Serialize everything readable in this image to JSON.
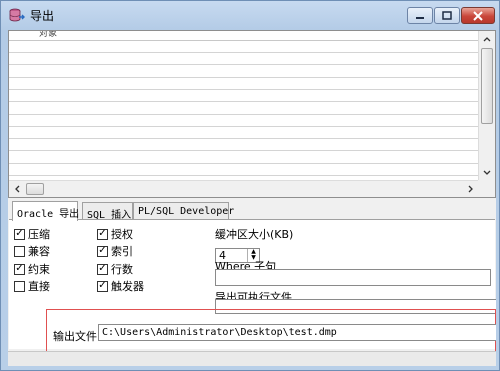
{
  "window": {
    "title": "导出",
    "icon": "database-export-icon",
    "minimize_glyph": "▬",
    "maximize_glyph": "▢",
    "close_glyph": "✕"
  },
  "grid": {
    "header_label": "对象",
    "row_count": 11
  },
  "tabs": [
    {
      "label": "Oracle 导出",
      "active": true
    },
    {
      "label": "SQL 插入",
      "active": false
    },
    {
      "label": "PL/SQL Developer",
      "active": false
    }
  ],
  "options_left": [
    {
      "label": "压缩",
      "checked": true
    },
    {
      "label": "兼容",
      "checked": false
    },
    {
      "label": "约束",
      "checked": true
    },
    {
      "label": "直接",
      "checked": false
    }
  ],
  "options_right": [
    {
      "label": "授权",
      "checked": true
    },
    {
      "label": "索引",
      "checked": true
    },
    {
      "label": "行数",
      "checked": true
    },
    {
      "label": "触发器",
      "checked": true
    }
  ],
  "buffer": {
    "label": "缓冲区大小(KB)",
    "value": "4"
  },
  "where": {
    "label": "Where 子句",
    "value": ""
  },
  "executable": {
    "label": "导出可执行文件",
    "value": ""
  },
  "output": {
    "label": "输出文件",
    "value": "C:\\Users\\Administrator\\Desktop\\test.dmp"
  },
  "colors": {
    "highlight_border": "#e05050",
    "titlebar": "#c7daf0"
  }
}
